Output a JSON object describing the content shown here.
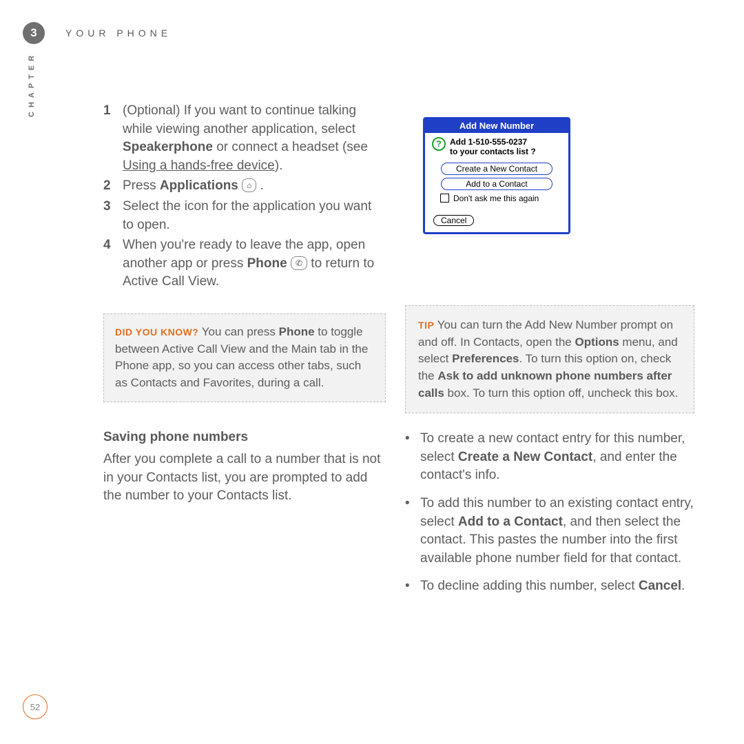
{
  "header": {
    "chapter_number": "3",
    "chapter_title": "YOUR PHONE",
    "side_label": "CHAPTER"
  },
  "steps": {
    "s1": {
      "n": "1",
      "lead": "(Optional)  If you want to continue talking while viewing another application, select ",
      "bold1": "Speakerphone",
      "mid": " or connect a headset (see ",
      "link": "Using a hands-free device",
      "tail": ")."
    },
    "s2": {
      "n": "2",
      "pre": "Press ",
      "bold": "Applications",
      "post": " ",
      "icon": "⌂",
      "end": " ."
    },
    "s3": {
      "n": "3",
      "text": "Select the icon for the application you want to open."
    },
    "s4": {
      "n": "4",
      "pre": "When you're ready to leave the app, open another app or press ",
      "bold": "Phone",
      "post": " ",
      "icon": "✆",
      "tail": " to return to Active Call View."
    }
  },
  "didyouknow": {
    "label": "DID YOU KNOW?",
    "pre": "  You can press ",
    "bold": "Phone",
    "post": " to toggle between Active Call View and the Main tab in the Phone app, so you can access other tabs, such as Contacts and Favorites, during a call."
  },
  "saving": {
    "heading": "Saving phone numbers",
    "para": "After you complete a call to a number that is not in your Contacts list, you are prompted to add the number to your Contacts list."
  },
  "dialog": {
    "title": "Add New Number",
    "line1": "Add 1-510-555-0237",
    "line2": "to your contacts list ?",
    "btn_new": "Create a New Contact",
    "btn_add": "Add to a Contact",
    "check": "Don't ask me this again",
    "cancel": "Cancel"
  },
  "tip": {
    "label": "TIP",
    "pre": "  You can turn the Add New Number prompt on and off. In Contacts, open the ",
    "bold1": "Options",
    "mid1": " menu, and select ",
    "bold2": "Preferences",
    "mid2": ". To turn this option on, check the ",
    "bold3": "Ask to add unknown phone numbers after calls",
    "tail": " box. To turn this option off, uncheck this box."
  },
  "bullets": {
    "b1": {
      "pre": "To create a new contact entry for this number, select ",
      "bold": "Create a New Contact",
      "post": ", and enter the contact's info."
    },
    "b2": {
      "pre": "To add this number to an existing contact entry, select ",
      "bold": "Add to a Contact",
      "post": ", and then select the contact. This pastes the number into the first available phone number field for that contact."
    },
    "b3": {
      "pre": "To decline adding this number, select ",
      "bold": "Cancel",
      "post": "."
    }
  },
  "page_number": "52"
}
